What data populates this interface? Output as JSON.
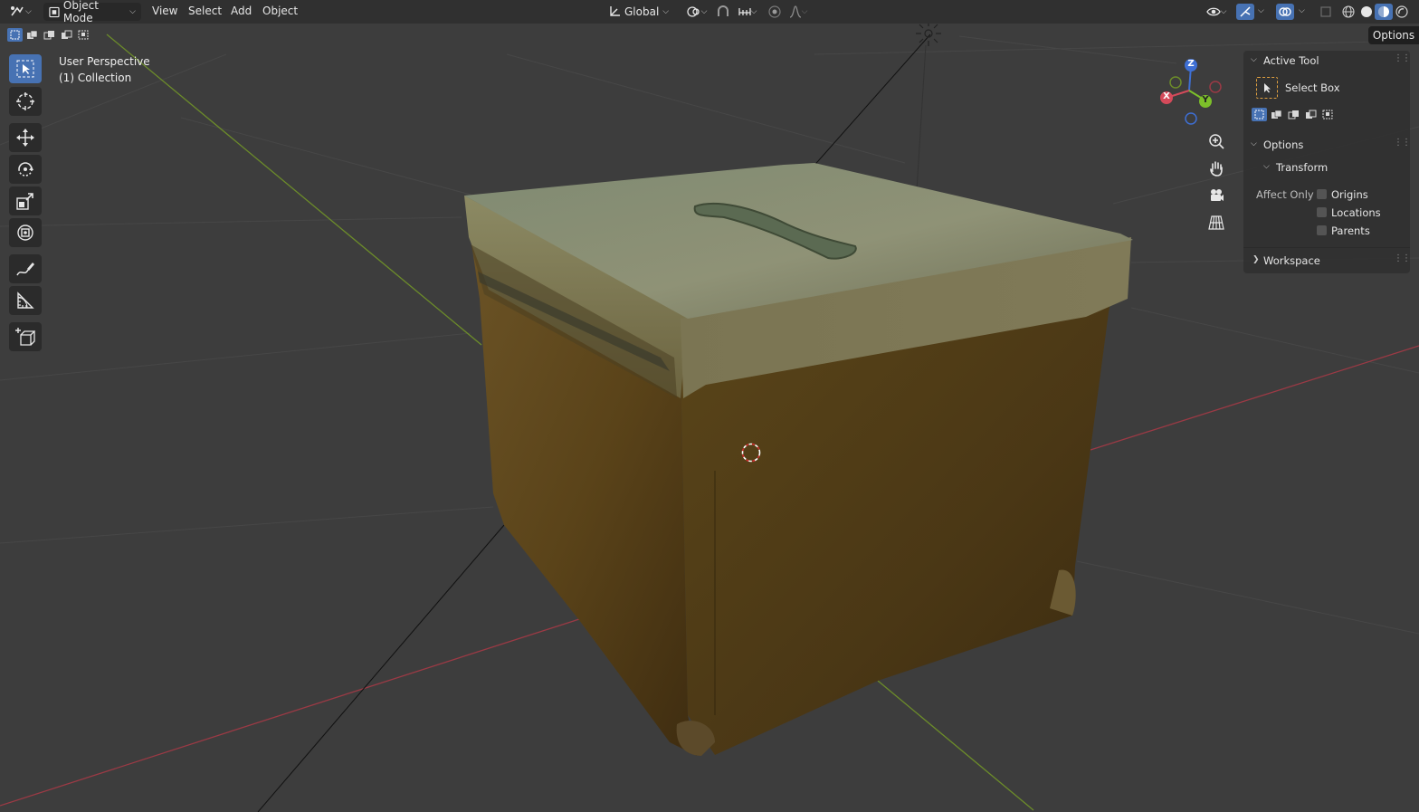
{
  "header": {
    "mode_label": "Object Mode",
    "menus": [
      "View",
      "Select",
      "Add",
      "Object"
    ],
    "orientation_label": "Global",
    "icons": [
      "editor-type-icon",
      "object-mode-icon",
      "transform-orientation-icon",
      "pivot-icon",
      "snap-icon",
      "snap-increment-icon",
      "proportional-edit-icon",
      "falloff-icon",
      "visibility-icon",
      "gizmo-icon",
      "overlay-icon",
      "xray-icon",
      "wireframe-shading-icon",
      "solid-shading-icon",
      "material-shading-icon",
      "rendered-shading-icon"
    ]
  },
  "viewport": {
    "perspective_label": "User Perspective",
    "collection_label": "(1) Collection",
    "axes": {
      "x": "X",
      "y": "Y",
      "z": "Z"
    },
    "colors": {
      "background": "#3d3d3d",
      "grid": "#474747",
      "x_axis": "#9b3a45",
      "y_axis": "#6c8c2a",
      "accent": "#4772b3"
    }
  },
  "toolbar": {
    "tools": [
      "select-box",
      "cursor",
      "move",
      "rotate",
      "scale",
      "transform",
      "annotate",
      "measure",
      "add-cube"
    ]
  },
  "sidebar": {
    "tab_label": "Options",
    "active_tool_title": "Active Tool",
    "active_tool_name": "Select Box",
    "options_title": "Options",
    "transform_title": "Transform",
    "affect_only_label": "Affect Only",
    "checkboxes": [
      {
        "label": "Origins",
        "checked": false
      },
      {
        "label": "Locations",
        "checked": false
      },
      {
        "label": "Parents",
        "checked": false
      }
    ],
    "workspace_title": "Workspace"
  }
}
